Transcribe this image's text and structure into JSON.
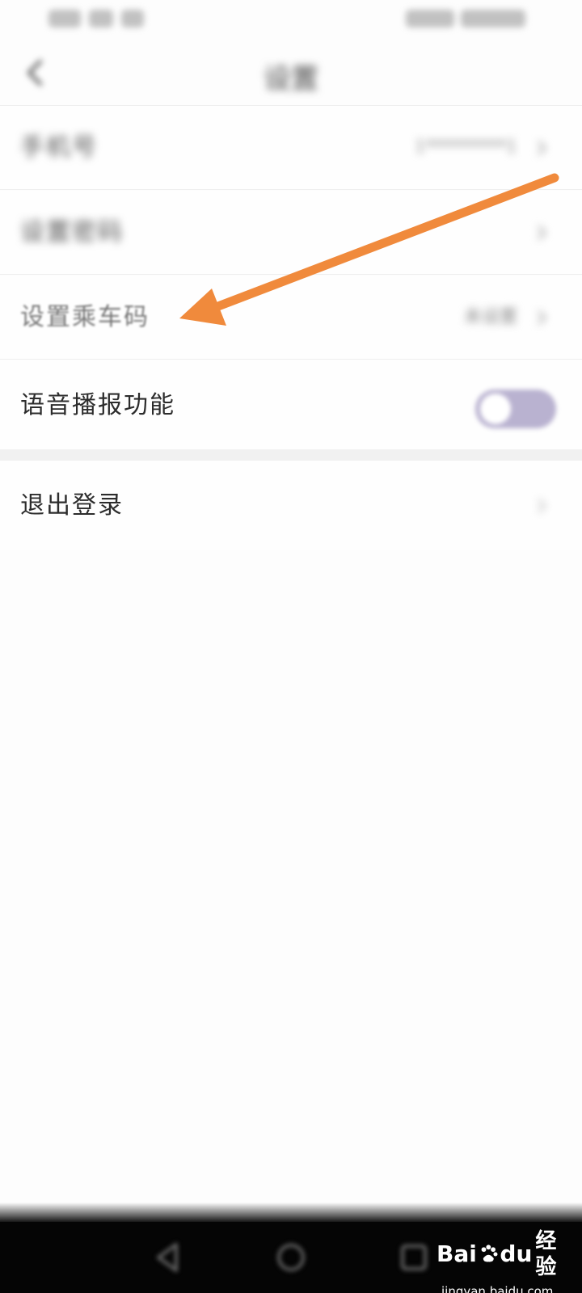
{
  "settings": {
    "items": [
      {
        "label": "手机号",
        "value": "1*********1"
      },
      {
        "label": "设置密码",
        "value": ""
      },
      {
        "label": "设置乘车码",
        "value": "未设置"
      },
      {
        "label": "语音播报功能",
        "toggle": "off"
      },
      {
        "label": "退出登录"
      }
    ]
  },
  "header": {
    "title": "设置"
  },
  "watermark": {
    "brand": "Bai",
    "brand_suffix": "du",
    "jingyan": "经验",
    "url": "jingyan.baidu.com"
  },
  "colors": {
    "arrow": "#f08a3c",
    "toggle_track": "#b9b2d0",
    "nav_bar": "#050505"
  }
}
